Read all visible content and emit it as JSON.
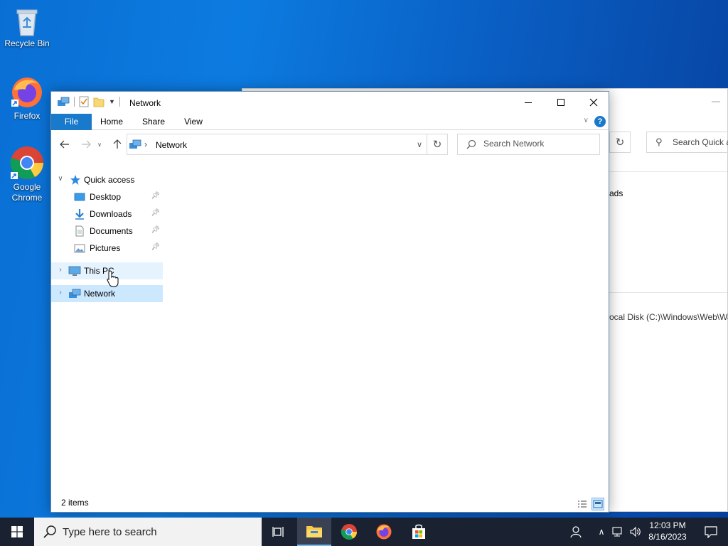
{
  "desktop": {
    "icons": [
      {
        "label": "Recycle Bin",
        "icon": "recycle-bin-icon"
      },
      {
        "label": "Firefox",
        "icon": "firefox-icon"
      },
      {
        "label": "Google Chrome",
        "icon": "chrome-icon"
      }
    ]
  },
  "background_window": {
    "search_placeholder": "Search Quick a",
    "text1": "ads",
    "text2": "ocal Disk (C:)\\Windows\\Web\\Wa"
  },
  "window": {
    "title": "Network",
    "tabs": [
      {
        "label": "File"
      },
      {
        "label": "Home"
      },
      {
        "label": "Share"
      },
      {
        "label": "View"
      }
    ],
    "help_label": "?",
    "address": {
      "crumb": "Network"
    },
    "search": {
      "placeholder": "Search Network"
    },
    "nav": {
      "quick_access": "Quick access",
      "items": [
        {
          "label": "Desktop",
          "icon": "desktop-folder-icon",
          "pinned": true
        },
        {
          "label": "Downloads",
          "icon": "downloads-folder-icon",
          "pinned": true
        },
        {
          "label": "Documents",
          "icon": "documents-folder-icon",
          "pinned": true
        },
        {
          "label": "Pictures",
          "icon": "pictures-folder-icon",
          "pinned": true
        }
      ],
      "this_pc": "This PC",
      "network": "Network"
    },
    "status": "2 items"
  },
  "taskbar": {
    "search_text": "Type here to search",
    "apps": [
      "task-view-icon",
      "file-explorer-icon",
      "chrome-icon",
      "firefox-icon",
      "store-icon"
    ],
    "clock": {
      "time": "12:03 PM",
      "date": "8/16/2023"
    }
  },
  "colors": {
    "accent": "#1979ca",
    "selection": "#cce8ff",
    "hover": "#e5f3ff",
    "taskbar": "#1a2130"
  }
}
